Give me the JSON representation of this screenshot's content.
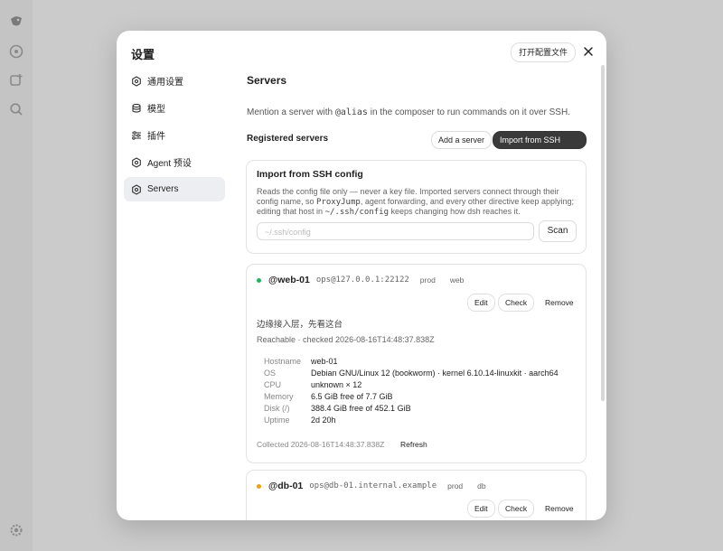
{
  "modal": {
    "title": "设置",
    "open_config_label": "打开配置文件"
  },
  "sidebar": {
    "items": [
      {
        "label": "通用设置",
        "icon": "gear-icon"
      },
      {
        "label": "模型",
        "icon": "database-icon"
      },
      {
        "label": "插件",
        "icon": "sliders-icon"
      },
      {
        "label": "Agent 预设",
        "icon": "gear-icon"
      },
      {
        "label": "Servers",
        "icon": "gear-icon",
        "active": true
      }
    ]
  },
  "servers": {
    "title": "Servers",
    "intro_prefix": "Mention a server with ",
    "intro_code": "@alias",
    "intro_suffix": " in the composer to run commands on it over SSH.",
    "registered_title": "Registered servers",
    "add_label": "Add a server",
    "import_label": "Import from SSH config",
    "import_card": {
      "title": "Import from SSH config",
      "desc_1": "Reads the config file only — never a key file. Imported servers connect through their config name, so ",
      "desc_code_1": "ProxyJump",
      "desc_2": ", agent forwarding, and every other directive keep applying; editing that host in ",
      "desc_code_2": "~/.ssh/config",
      "desc_3": " keeps changing how dsh reaches it.",
      "placeholder": "~/.ssh/config",
      "scan_label": "Scan"
    },
    "list": [
      {
        "alias": "@web-01",
        "address": "ops@127.0.0.1:22122",
        "tags": [
          "prod",
          "web"
        ],
        "status_color": "#22b35e",
        "edit": "Edit",
        "check": "Check",
        "remove": "Remove",
        "note": "边缘接入层，先看这台",
        "status": "Reachable · checked 2026-08-16T14:48:37.838Z",
        "details": [
          {
            "k": "Hostname",
            "v": "web-01"
          },
          {
            "k": "OS",
            "v": "Debian GNU/Linux 12 (bookworm) · kernel 6.10.14-linuxkit · aarch64"
          },
          {
            "k": "CPU",
            "v": "unknown × 12"
          },
          {
            "k": "Memory",
            "v": "6.5 GiB free of 7.7 GiB"
          },
          {
            "k": "Disk (/)",
            "v": "388.4 GiB free of 452.1 GiB"
          },
          {
            "k": "Uptime",
            "v": "2d 20h"
          }
        ],
        "collected": "Collected 2026-08-16T14:48:37.838Z",
        "refresh": "Refresh"
      },
      {
        "alias": "@db-01",
        "address": "ops@db-01.internal.example",
        "tags": [
          "prod",
          "db"
        ],
        "status_color": "#e8a317",
        "edit": "Edit",
        "check": "Check",
        "remove": "Remove"
      }
    ]
  }
}
